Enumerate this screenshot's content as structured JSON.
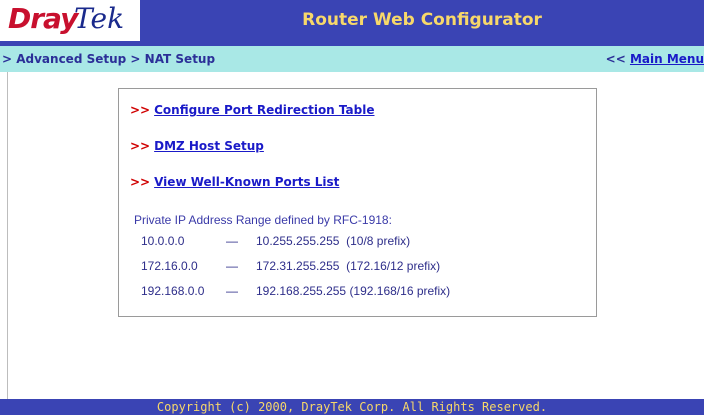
{
  "header": {
    "logo_part1": "Dray",
    "logo_part2": "Tek",
    "title": "Router Web Configurator"
  },
  "nav": {
    "breadcrumb": "> Advanced Setup > NAT Setup",
    "main_menu_prefix": "<< ",
    "main_menu_label": "Main Menu"
  },
  "links": [
    {
      "arrow": ">>",
      "label": "Configure Port Redirection Table"
    },
    {
      "arrow": ">>",
      "label": "DMZ Host Setup"
    },
    {
      "arrow": ">>",
      "label": "View Well-Known Ports List"
    }
  ],
  "rfc": {
    "title": "Private IP Address Range defined by RFC-1918:",
    "ranges": [
      {
        "start": "10.0.0.0",
        "dash": "—",
        "end": "10.255.255.255",
        "prefix": "(10/8 prefix)"
      },
      {
        "start": "172.16.0.0",
        "dash": "—",
        "end": "172.31.255.255",
        "prefix": "(172.16/12 prefix)"
      },
      {
        "start": "192.168.0.0",
        "dash": "—",
        "end": "192.168.255.255",
        "prefix": "(192.168/16 prefix)"
      }
    ]
  },
  "footer": {
    "copyright": "Copyright (c) 2000, DrayTek Corp. All Rights Reserved."
  },
  "colors": {
    "header_bg": "#3a44b4",
    "title_text": "#f7d86a",
    "nav_bg": "#a9e8e6",
    "link": "#1a1ac8",
    "arrow": "#d00000"
  }
}
